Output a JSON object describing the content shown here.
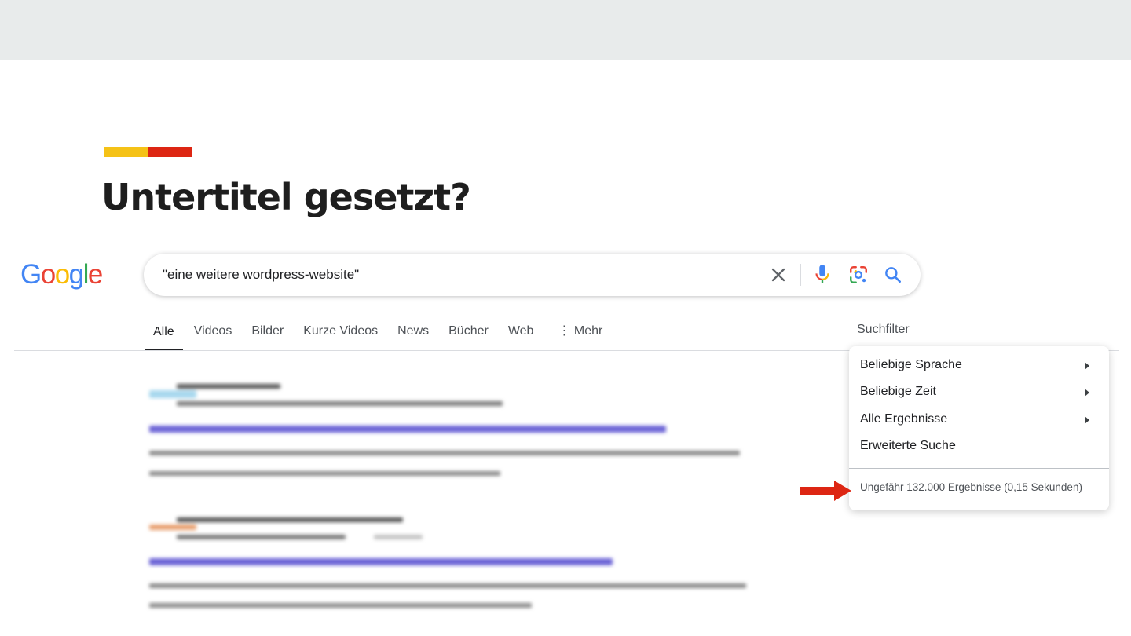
{
  "colors": {
    "accent_yellow": "#f5c217",
    "accent_red": "#dd2613",
    "google_blue": "#4285f4",
    "google_red": "#ea4335",
    "google_yellow": "#fbbc05",
    "google_green": "#34a853",
    "arrow_red": "#dd2613"
  },
  "slide": {
    "title": "Untertitel gesetzt?"
  },
  "google": {
    "logo_letters": [
      "G",
      "o",
      "o",
      "g",
      "l",
      "e"
    ],
    "search": {
      "query": "\"eine weitere wordpress-website\"",
      "icons": [
        "close-icon",
        "microphone-icon",
        "google-lens-icon",
        "search-icon"
      ]
    },
    "tabs": [
      {
        "label": "Alle",
        "active": true
      },
      {
        "label": "Videos",
        "active": false
      },
      {
        "label": "Bilder",
        "active": false
      },
      {
        "label": "Kurze Videos",
        "active": false
      },
      {
        "label": "News",
        "active": false
      },
      {
        "label": "Bücher",
        "active": false
      },
      {
        "label": "Web",
        "active": false
      },
      {
        "label": "⋮ Mehr",
        "active": false
      }
    ],
    "filter_label": "Suchfilter",
    "filter_menu": {
      "items": [
        {
          "label": "Beliebige Sprache",
          "has_submenu": true
        },
        {
          "label": "Beliebige Zeit",
          "has_submenu": true
        },
        {
          "label": "Alle Ergebnisse",
          "has_submenu": true
        },
        {
          "label": "Erweiterte Suche",
          "has_submenu": false
        }
      ],
      "result_stats": "Ungefähr 132.000 Ergebnisse (0,15 Sekunden)"
    },
    "results_blurred": true
  }
}
